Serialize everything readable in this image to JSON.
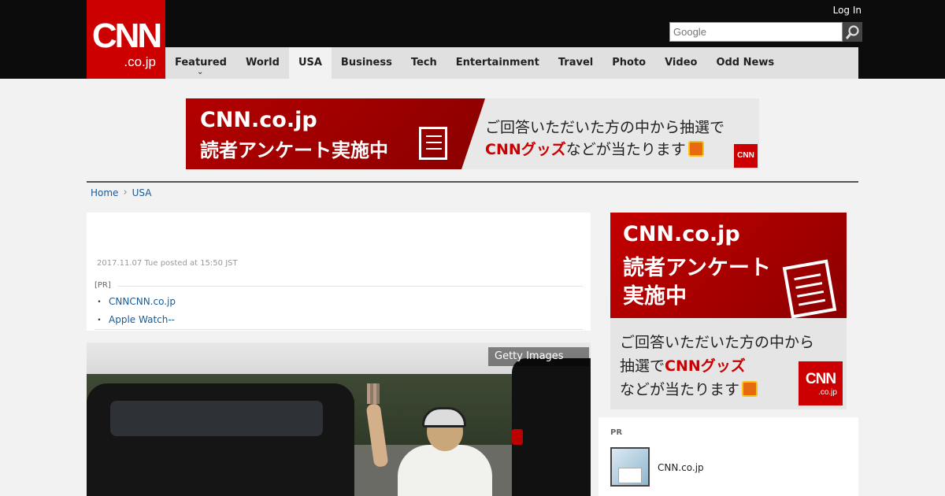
{
  "header": {
    "logo": {
      "main": "CNN",
      "sub": ".co.jp"
    },
    "login_label": "Log In",
    "search": {
      "placeholder": "Google"
    }
  },
  "nav": {
    "items": [
      {
        "label": "Featured",
        "has_dropdown": true
      },
      {
        "label": "World"
      },
      {
        "label": "USA",
        "active": true
      },
      {
        "label": "Business"
      },
      {
        "label": "Tech"
      },
      {
        "label": "Entertainment"
      },
      {
        "label": "Travel"
      },
      {
        "label": "Photo"
      },
      {
        "label": "Video"
      },
      {
        "label": "Odd News"
      }
    ]
  },
  "banner": {
    "line1": "CNN.co.jp",
    "line2": "読者アンケート実施中",
    "line3": "ご回答いただいた方の中から抽選で",
    "line4_highlight": "CNNグッズ",
    "line4_rest": "などが当たります",
    "logo": "CNN"
  },
  "breadcrumb": {
    "home": "Home",
    "section": "USA"
  },
  "article": {
    "date": "2017.11.07 Tue posted at 15:50 JST",
    "pr_label": "[PR]",
    "pr_links": [
      "CNNCNN.co.jp",
      "Apple Watch--"
    ],
    "photo_credit": "Getty Images"
  },
  "side_ad": {
    "line1": "CNN.co.jp",
    "line2": "読者アンケート",
    "line3": "実施中",
    "line4": "ご回答いただいた方の中から",
    "line5_pre": "抽選で",
    "line5_highlight": "CNNグッズ",
    "line6": "などが当たります",
    "logo_main": "CNN",
    "logo_sub": ".co.jp"
  },
  "pr_box": {
    "heading": "PR",
    "item_title": "CNN.co.jp"
  },
  "colors": {
    "brand_red": "#cc0000",
    "link_blue": "#1a5a96",
    "header_bg": "#0c0c0c"
  }
}
